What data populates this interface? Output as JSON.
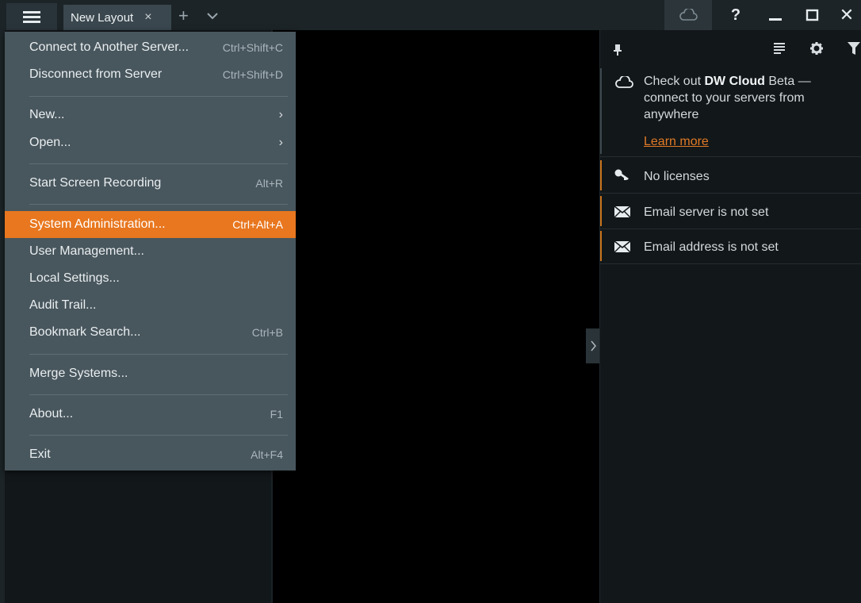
{
  "titlebar": {
    "tab_label": "New Layout",
    "tab_close": "×",
    "add_tab": "+",
    "help": "?",
    "close": "✕"
  },
  "menu": {
    "items": [
      {
        "label": "Connect to Another Server...",
        "shortcut": "Ctrl+Shift+C"
      },
      {
        "label": "Disconnect from Server",
        "shortcut": "Ctrl+Shift+D"
      },
      {
        "label": "New...",
        "shortcut": "›"
      },
      {
        "label": "Open...",
        "shortcut": "›"
      },
      {
        "label": "Start Screen Recording",
        "shortcut": "Alt+R"
      },
      {
        "label": "System Administration...",
        "shortcut": "Ctrl+Alt+A"
      },
      {
        "label": "User Management...",
        "shortcut": ""
      },
      {
        "label": "Local Settings...",
        "shortcut": ""
      },
      {
        "label": "Audit Trail...",
        "shortcut": ""
      },
      {
        "label": "Bookmark Search...",
        "shortcut": "Ctrl+B"
      },
      {
        "label": "Merge Systems...",
        "shortcut": ""
      },
      {
        "label": "About...",
        "shortcut": "F1"
      },
      {
        "label": "Exit",
        "shortcut": "Alt+F4"
      }
    ]
  },
  "notifications": {
    "cloud_prefix": "Check out ",
    "cloud_brand": "DW Cloud",
    "cloud_suffix": " Beta — connect to your servers from anywhere",
    "learn_more": "Learn more",
    "licenses": "No licenses",
    "email_server": "Email server is not set",
    "email_address": "Email address is not set"
  },
  "colors": {
    "accent": "#e8771f",
    "menu_bg": "#48565d",
    "panel_bg": "#121719"
  }
}
